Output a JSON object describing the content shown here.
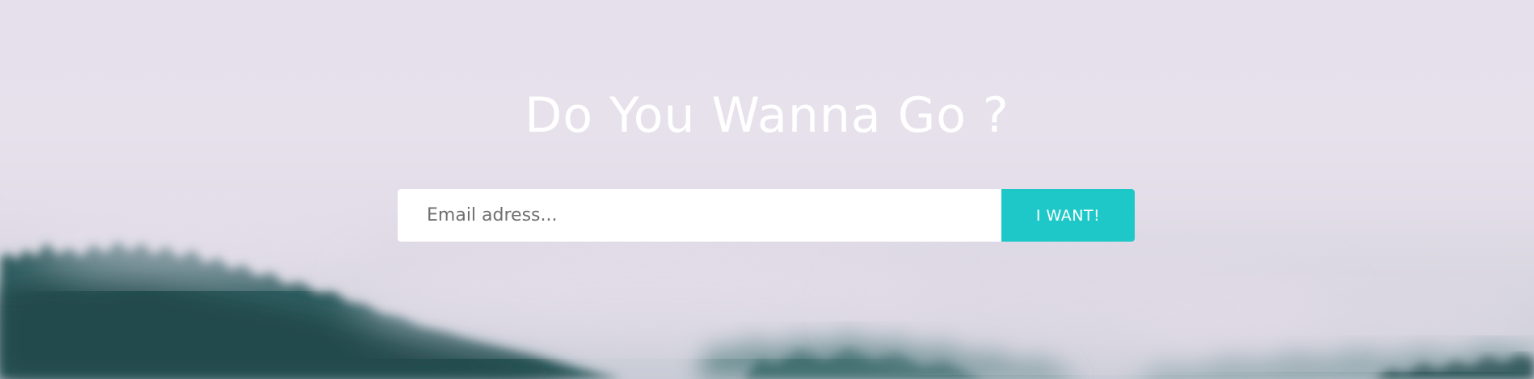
{
  "hero": {
    "title": "Do You Wanna Go ?",
    "background_icon": "misty-forest-image"
  },
  "signup": {
    "email_placeholder": "Email adress...",
    "email_value": "",
    "button_label": "I WANT!"
  },
  "colors": {
    "accent": "#1fc8c8",
    "sky": "#e6e0ec",
    "forest": "#1f4a4a",
    "text": "#ffffff"
  }
}
